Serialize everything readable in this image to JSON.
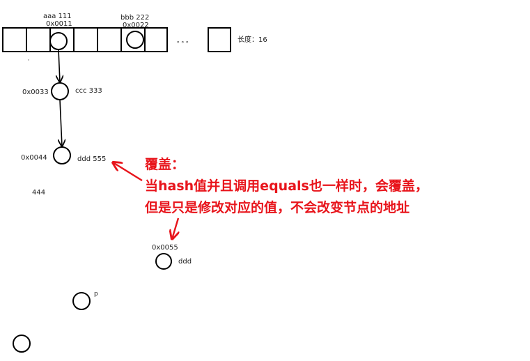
{
  "array": {
    "slot_count": 8,
    "length_label": "长度：16",
    "ellipsis": "。。。",
    "entries": [
      {
        "slot": 2,
        "key_value": "aaa  111",
        "address": "0x0011"
      },
      {
        "slot": 5,
        "key_value": "bbb 222",
        "address": "0x0022"
      }
    ]
  },
  "nodes": {
    "n0033": {
      "address": "0x0033",
      "key_value": "ccc 333"
    },
    "n0044": {
      "address": "0x0044",
      "key_value": "ddd  555",
      "old_value": "444"
    },
    "n0055": {
      "address": "0x0055",
      "key_value": "ddd"
    },
    "np": {
      "key_value": "p"
    },
    "nlast": {}
  },
  "annotation": {
    "title": "覆盖：",
    "line1": "当hash值并且调用equals也一样时，会覆盖，",
    "line2": "但是只是修改对应的值，不会改变节点的地址",
    "color": "#e8141b"
  }
}
